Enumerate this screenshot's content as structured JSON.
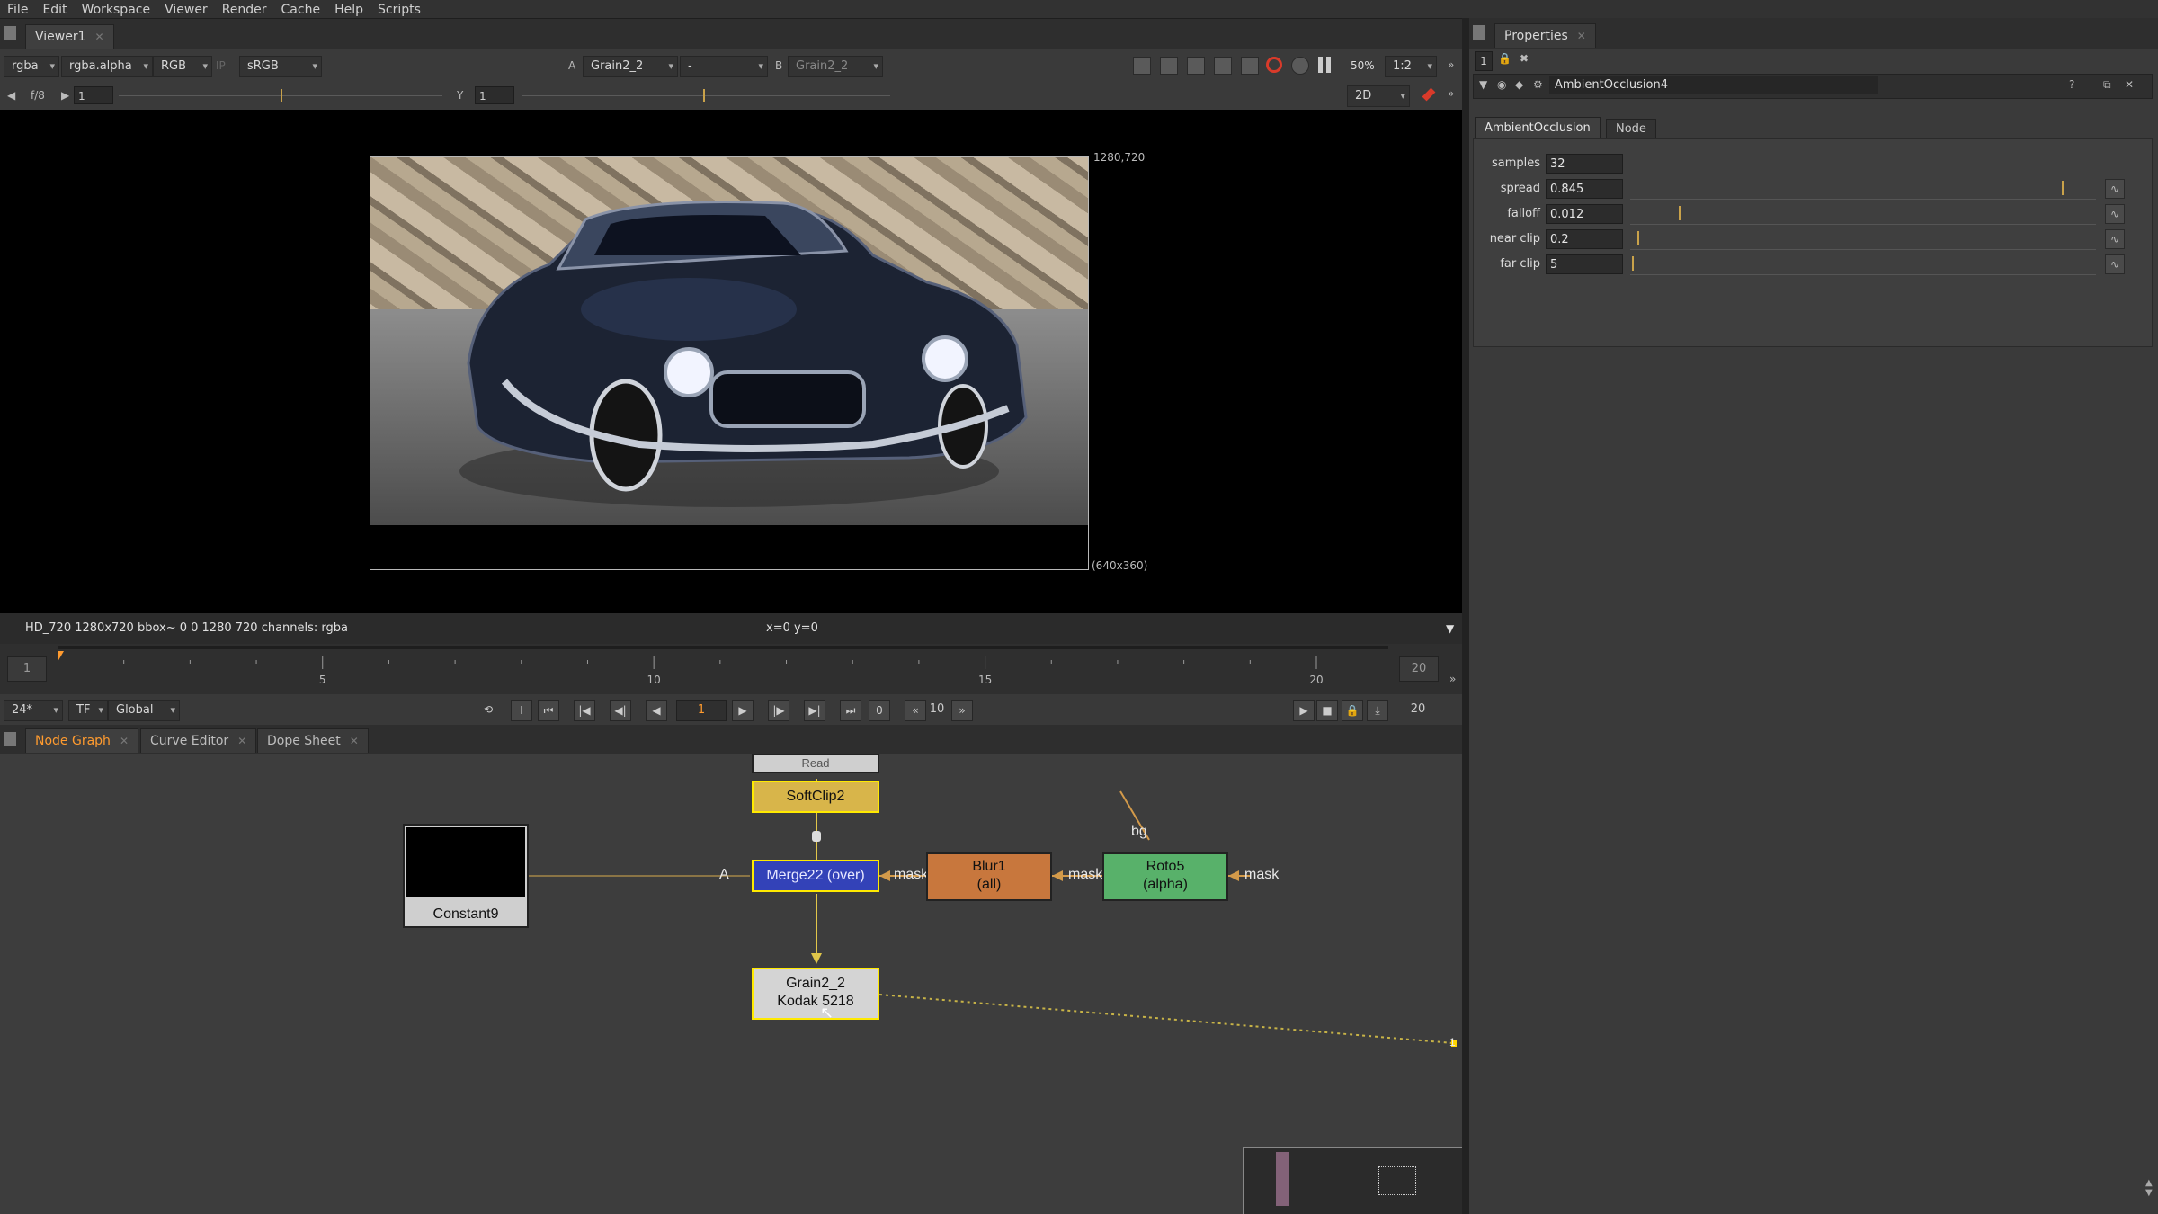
{
  "menu": [
    "File",
    "Edit",
    "Workspace",
    "Viewer",
    "Render",
    "Cache",
    "Help",
    "Scripts"
  ],
  "viewer_tab": {
    "label": "Viewer1"
  },
  "viewer_toolbar": {
    "channels": "rgba",
    "alpha": "rgba.alpha",
    "colorspace": "RGB",
    "ip": "IP",
    "lut": "sRGB",
    "a_label": "A",
    "a_input": "Grain2_2",
    "a_op": "-",
    "b_label": "B",
    "b_input": "Grain2_2",
    "zoom": "50%",
    "ratio": "1:2",
    "view_mode": "2D",
    "gain_label": "f/8",
    "gain_value": "1",
    "gamma_label": "Y",
    "gamma_value": "1"
  },
  "viewer": {
    "format_label": "1280,720",
    "proxy_label": "(640x360)"
  },
  "status": {
    "info": "HD_720 1280x720  bbox~ 0 0 1280 720 channels: rgba",
    "coords": "x=0 y=0"
  },
  "timeline": {
    "start": "1",
    "end": "20",
    "ticks": [
      "1",
      "5",
      "10",
      "15",
      "20"
    ],
    "current_frame": 1,
    "frame_range": [
      1,
      20
    ]
  },
  "playback": {
    "fps": "24*",
    "tf": "TF",
    "scope": "Global",
    "frame": "1",
    "zero": "0",
    "increment": "10",
    "end_field": "20"
  },
  "graph_tabs": [
    "Node Graph",
    "Curve Editor",
    "Dope Sheet"
  ],
  "nodes": {
    "top_partial": "Read",
    "softclip": "SoftClip2",
    "merge": "Merge22 (over)",
    "blur1_line1": "Blur1",
    "blur1_line2": "(all)",
    "roto_line1": "Roto5",
    "roto_line2": "(alpha)",
    "constant": "Constant9",
    "grain_line1": "Grain2_2",
    "grain_line2": "Kodak 5218",
    "mask_label": "mask",
    "bg_label": "bg",
    "a_label": "A",
    "viewer_input": "1"
  },
  "properties": {
    "tab_label": "Properties",
    "node_name": "AmbientOcclusion4",
    "tabs": [
      "AmbientOcclusion",
      "Node"
    ],
    "params": [
      {
        "label": "samples",
        "value": "32"
      },
      {
        "label": "spread",
        "value": "0.845"
      },
      {
        "label": "falloff",
        "value": "0.012"
      },
      {
        "label": "near clip",
        "value": "0.2"
      },
      {
        "label": "far clip",
        "value": "5"
      }
    ],
    "lock_label": "1"
  },
  "colors": {
    "accent": "#ff9b2f",
    "selection": "#ffea00",
    "merge": "#3342b8",
    "blur": "#c8773d",
    "roto": "#58b16a",
    "grain": "#d4d4d4",
    "softclip": "#d8b54a"
  }
}
